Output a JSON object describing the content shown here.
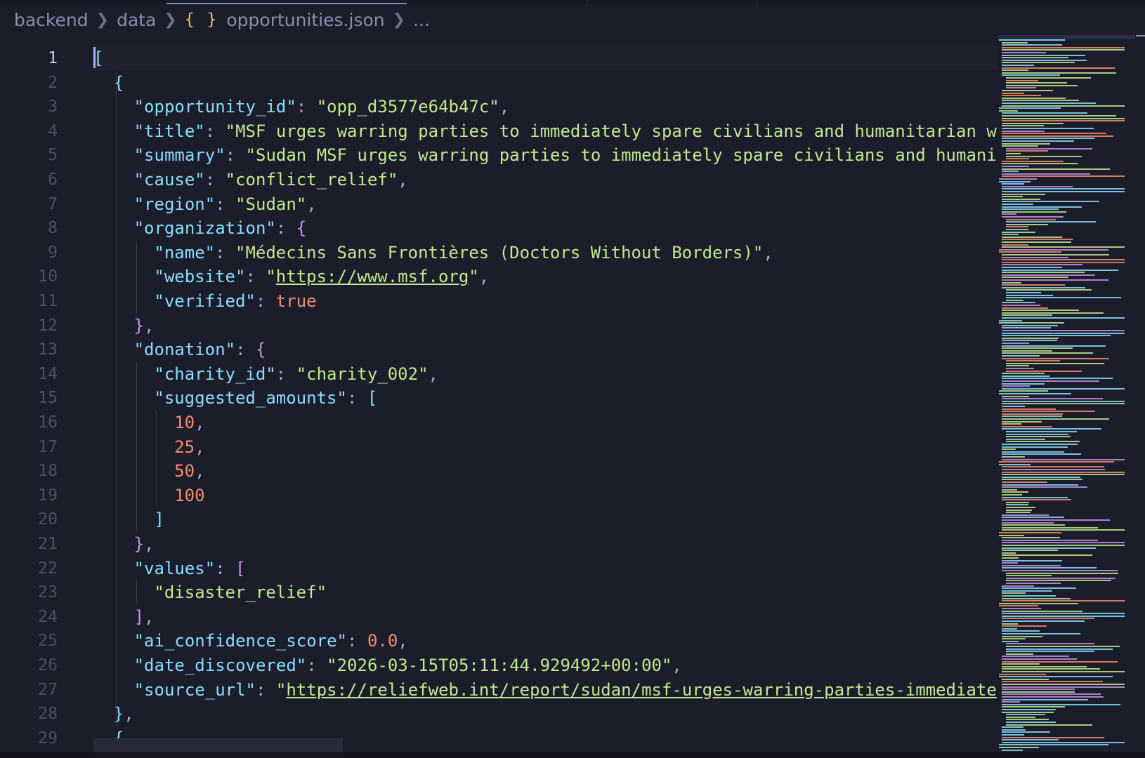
{
  "breadcrumb": {
    "items": [
      "backend",
      "data"
    ],
    "file_icon": "{ }",
    "file_name": "opportunities.json",
    "trailing": "..."
  },
  "editor": {
    "language": "json",
    "active_line": 1,
    "lines": [
      {
        "n": "1",
        "indent": 0,
        "tokens": [
          {
            "t": "[",
            "c": "br"
          }
        ]
      },
      {
        "n": "2",
        "indent": 1,
        "tokens": [
          {
            "t": "{",
            "c": "br"
          }
        ]
      },
      {
        "n": "3",
        "indent": 2,
        "tokens": [
          {
            "t": "\"opportunity_id\"",
            "c": "k"
          },
          {
            "t": ": ",
            "c": "p"
          },
          {
            "t": "\"opp_d3577e64b47c\"",
            "c": "s"
          },
          {
            "t": ",",
            "c": "p"
          }
        ]
      },
      {
        "n": "4",
        "indent": 2,
        "tokens": [
          {
            "t": "\"title\"",
            "c": "k"
          },
          {
            "t": ": ",
            "c": "p"
          },
          {
            "t": "\"MSF urges warring parties to immediately spare civilians and humanitarian w",
            "c": "s"
          }
        ]
      },
      {
        "n": "5",
        "indent": 2,
        "tokens": [
          {
            "t": "\"summary\"",
            "c": "k"
          },
          {
            "t": ": ",
            "c": "p"
          },
          {
            "t": "\"Sudan MSF urges warring parties to immediately spare civilians and humani",
            "c": "s"
          }
        ]
      },
      {
        "n": "6",
        "indent": 2,
        "tokens": [
          {
            "t": "\"cause\"",
            "c": "k"
          },
          {
            "t": ": ",
            "c": "p"
          },
          {
            "t": "\"conflict_relief\"",
            "c": "s"
          },
          {
            "t": ",",
            "c": "p"
          }
        ]
      },
      {
        "n": "7",
        "indent": 2,
        "tokens": [
          {
            "t": "\"region\"",
            "c": "k"
          },
          {
            "t": ": ",
            "c": "p"
          },
          {
            "t": "\"Sudan\"",
            "c": "s"
          },
          {
            "t": ",",
            "c": "p"
          }
        ]
      },
      {
        "n": "8",
        "indent": 2,
        "tokens": [
          {
            "t": "\"organization\"",
            "c": "k"
          },
          {
            "t": ": ",
            "c": "p"
          },
          {
            "t": "{",
            "c": "b"
          }
        ]
      },
      {
        "n": "9",
        "indent": 3,
        "tokens": [
          {
            "t": "\"name\"",
            "c": "k"
          },
          {
            "t": ": ",
            "c": "p"
          },
          {
            "t": "\"Médecins Sans Frontières (Doctors Without Borders)\"",
            "c": "s"
          },
          {
            "t": ",",
            "c": "p"
          }
        ]
      },
      {
        "n": "10",
        "indent": 3,
        "tokens": [
          {
            "t": "\"website\"",
            "c": "k"
          },
          {
            "t": ": ",
            "c": "p"
          },
          {
            "t": "\"",
            "c": "s"
          },
          {
            "t": "https://www.msf.org",
            "c": "u"
          },
          {
            "t": "\"",
            "c": "s"
          },
          {
            "t": ",",
            "c": "p"
          }
        ]
      },
      {
        "n": "11",
        "indent": 3,
        "tokens": [
          {
            "t": "\"verified\"",
            "c": "k"
          },
          {
            "t": ": ",
            "c": "p"
          },
          {
            "t": "true",
            "c": "n"
          }
        ]
      },
      {
        "n": "12",
        "indent": 2,
        "tokens": [
          {
            "t": "}",
            "c": "b"
          },
          {
            "t": ",",
            "c": "p"
          }
        ]
      },
      {
        "n": "13",
        "indent": 2,
        "tokens": [
          {
            "t": "\"donation\"",
            "c": "k"
          },
          {
            "t": ": ",
            "c": "p"
          },
          {
            "t": "{",
            "c": "b"
          }
        ]
      },
      {
        "n": "14",
        "indent": 3,
        "tokens": [
          {
            "t": "\"charity_id\"",
            "c": "k"
          },
          {
            "t": ": ",
            "c": "p"
          },
          {
            "t": "\"charity_002\"",
            "c": "s"
          },
          {
            "t": ",",
            "c": "p"
          }
        ]
      },
      {
        "n": "15",
        "indent": 3,
        "tokens": [
          {
            "t": "\"suggested_amounts\"",
            "c": "k"
          },
          {
            "t": ": ",
            "c": "p"
          },
          {
            "t": "[",
            "c": "br"
          }
        ]
      },
      {
        "n": "16",
        "indent": 4,
        "tokens": [
          {
            "t": "10",
            "c": "n"
          },
          {
            "t": ",",
            "c": "p"
          }
        ]
      },
      {
        "n": "17",
        "indent": 4,
        "tokens": [
          {
            "t": "25",
            "c": "n"
          },
          {
            "t": ",",
            "c": "p"
          }
        ]
      },
      {
        "n": "18",
        "indent": 4,
        "tokens": [
          {
            "t": "50",
            "c": "n"
          },
          {
            "t": ",",
            "c": "p"
          }
        ]
      },
      {
        "n": "19",
        "indent": 4,
        "tokens": [
          {
            "t": "100",
            "c": "n"
          }
        ]
      },
      {
        "n": "20",
        "indent": 3,
        "tokens": [
          {
            "t": "]",
            "c": "br"
          }
        ]
      },
      {
        "n": "21",
        "indent": 2,
        "tokens": [
          {
            "t": "}",
            "c": "b"
          },
          {
            "t": ",",
            "c": "p"
          }
        ]
      },
      {
        "n": "22",
        "indent": 2,
        "tokens": [
          {
            "t": "\"values\"",
            "c": "k"
          },
          {
            "t": ": ",
            "c": "p"
          },
          {
            "t": "[",
            "c": "b"
          }
        ]
      },
      {
        "n": "23",
        "indent": 3,
        "tokens": [
          {
            "t": "\"disaster_relief\"",
            "c": "s"
          }
        ]
      },
      {
        "n": "24",
        "indent": 2,
        "tokens": [
          {
            "t": "]",
            "c": "b"
          },
          {
            "t": ",",
            "c": "p"
          }
        ]
      },
      {
        "n": "25",
        "indent": 2,
        "tokens": [
          {
            "t": "\"ai_confidence_score\"",
            "c": "k"
          },
          {
            "t": ": ",
            "c": "p"
          },
          {
            "t": "0.0",
            "c": "n"
          },
          {
            "t": ",",
            "c": "p"
          }
        ]
      },
      {
        "n": "26",
        "indent": 2,
        "tokens": [
          {
            "t": "\"date_discovered\"",
            "c": "k"
          },
          {
            "t": ": ",
            "c": "p"
          },
          {
            "t": "\"2026-03-15T05:11:44.929492+00:00\"",
            "c": "s"
          },
          {
            "t": ",",
            "c": "p"
          }
        ]
      },
      {
        "n": "27",
        "indent": 2,
        "tokens": [
          {
            "t": "\"source_url\"",
            "c": "k"
          },
          {
            "t": ": ",
            "c": "p"
          },
          {
            "t": "\"",
            "c": "s"
          },
          {
            "t": "https://reliefweb.int/report/sudan/msf-urges-warring-parties-immediate",
            "c": "u"
          }
        ]
      },
      {
        "n": "28",
        "indent": 1,
        "tokens": [
          {
            "t": "}",
            "c": "br"
          },
          {
            "t": ",",
            "c": "p"
          }
        ]
      },
      {
        "n": "29",
        "indent": 1,
        "tokens": [
          {
            "t": "{",
            "c": "br"
          }
        ]
      }
    ]
  },
  "theme": {
    "background": "#1b1d2b",
    "key_color": "#89ddff",
    "string_color": "#c3e88d",
    "number_color": "#f78c6c",
    "bracket_color": "#c792ea",
    "line_number_color": "#4b5068",
    "active_line_number_color": "#c8ccde"
  }
}
